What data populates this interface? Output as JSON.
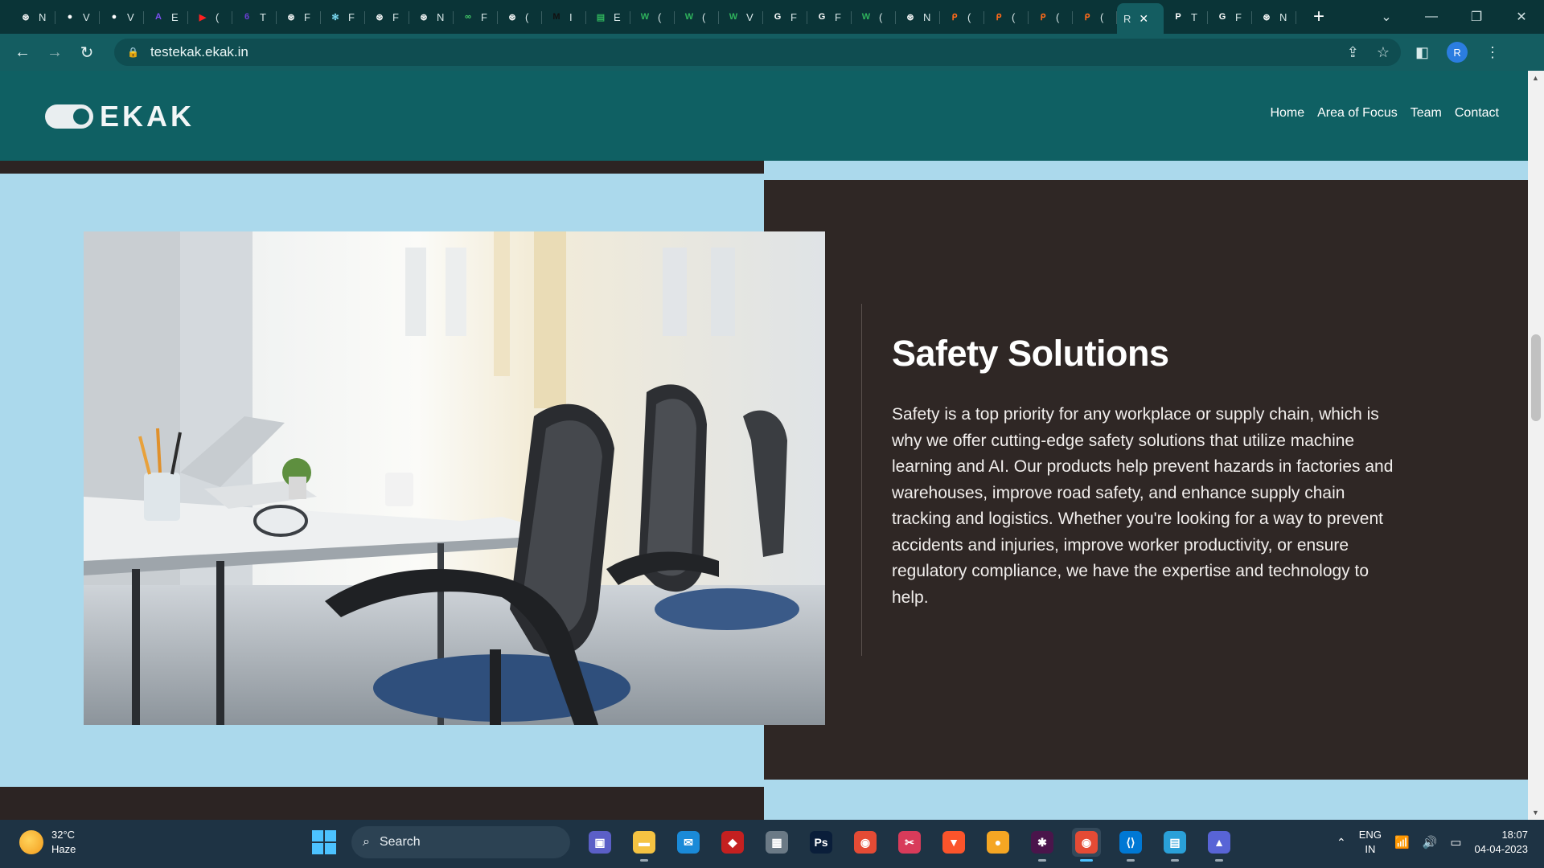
{
  "browser": {
    "tabs": [
      {
        "icon": "chatgpt-icon",
        "letter": "N",
        "color": "#ffffff",
        "glyph": "⊛"
      },
      {
        "icon": "github-icon",
        "letter": "V",
        "color": "#ffffff",
        "glyph": "●"
      },
      {
        "icon": "github-icon",
        "letter": "V",
        "color": "#ffffff",
        "glyph": "●"
      },
      {
        "icon": "app-a-icon",
        "letter": "E",
        "color": "#7b4ff0",
        "glyph": "A"
      },
      {
        "icon": "youtube-icon",
        "letter": "(",
        "color": "#ff2020",
        "glyph": "▶"
      },
      {
        "icon": "app-6-icon",
        "letter": "T",
        "color": "#6b3fd6",
        "glyph": "6"
      },
      {
        "icon": "openai-icon",
        "letter": "F",
        "color": "#ffffff",
        "glyph": "⊛"
      },
      {
        "icon": "react-icon",
        "letter": "F",
        "color": "#79d8f0",
        "glyph": "✻"
      },
      {
        "icon": "openai-icon",
        "letter": "F",
        "color": "#ffffff",
        "glyph": "⊛"
      },
      {
        "icon": "chatgpt-icon",
        "letter": "N",
        "color": "#ffffff",
        "glyph": "⊛"
      },
      {
        "icon": "infinity-icon",
        "letter": "F",
        "color": "#46d16b",
        "glyph": "∞"
      },
      {
        "icon": "openai-icon",
        "letter": "(",
        "color": "#ffffff",
        "glyph": "⊛"
      },
      {
        "icon": "medium-icon",
        "letter": "I",
        "color": "#111111",
        "glyph": "M"
      },
      {
        "icon": "sheets-icon",
        "letter": "E",
        "color": "#2fb35c",
        "glyph": "▤"
      },
      {
        "icon": "w-icon",
        "letter": "(",
        "color": "#2fb35c",
        "glyph": "W"
      },
      {
        "icon": "w-icon",
        "letter": "(",
        "color": "#2fb35c",
        "glyph": "W"
      },
      {
        "icon": "w-icon",
        "letter": "V",
        "color": "#2fb35c",
        "glyph": "W"
      },
      {
        "icon": "google-icon",
        "letter": "F",
        "color": "#ffffff",
        "glyph": "G"
      },
      {
        "icon": "google-icon",
        "letter": "F",
        "color": "#ffffff",
        "glyph": "G"
      },
      {
        "icon": "w-icon",
        "letter": "(",
        "color": "#2fb35c",
        "glyph": "W"
      },
      {
        "icon": "chatgpt-icon",
        "letter": "N",
        "color": "#ffffff",
        "glyph": "⊛"
      },
      {
        "icon": "p-orange-icon",
        "letter": "(",
        "color": "#ff6a1a",
        "glyph": "ᑭ"
      },
      {
        "icon": "p-orange-icon",
        "letter": "(",
        "color": "#ff6a1a",
        "glyph": "ᑭ"
      },
      {
        "icon": "p-orange-icon",
        "letter": "(",
        "color": "#ff6a1a",
        "glyph": "ᑭ"
      },
      {
        "icon": "p-orange-icon",
        "letter": "(",
        "color": "#ff6a1a",
        "glyph": "ᑭ"
      }
    ],
    "active_tab": {
      "letter": "R",
      "close": "✕"
    },
    "tabs_after": [
      {
        "icon": "p-black-icon",
        "letter": "T",
        "color": "#ffffff",
        "glyph": "P"
      },
      {
        "icon": "google-icon",
        "letter": "F",
        "color": "#ffffff",
        "glyph": "G"
      },
      {
        "icon": "chatgpt-icon",
        "letter": "N",
        "color": "#ffffff",
        "glyph": "⊛"
      }
    ],
    "new_tab": "+",
    "url": "testekak.ekak.in",
    "profile_initial": "R"
  },
  "site": {
    "logo_text": "EKAK",
    "nav": [
      "Home",
      "Area of Focus",
      "Team",
      "Contact"
    ],
    "feature_title": "Safety Solutions",
    "feature_body": "Safety is a top priority for any workplace or supply chain, which is why we offer cutting-edge safety solutions that utilize machine learning and AI. Our products help prevent hazards in factories and warehouses, improve road safety, and enhance supply chain tracking and logistics. Whether you're looking for a way to prevent accidents and injuries, improve worker productivity, or ensure regulatory compliance, we have the expertise and technology to help."
  },
  "taskbar": {
    "weather_temp": "32°C",
    "weather_desc": "Haze",
    "search_label": "Search",
    "apps": [
      {
        "name": "teams-icon",
        "glyph": "▣",
        "bg": "#5b5fc7",
        "running": false
      },
      {
        "name": "file-explorer-icon",
        "glyph": "▬",
        "bg": "#f5c342",
        "running": true
      },
      {
        "name": "mail-icon",
        "glyph": "✉",
        "bg": "#1a8ad8",
        "running": false
      },
      {
        "name": "app-red-icon",
        "glyph": "◆",
        "bg": "#c42020",
        "running": false
      },
      {
        "name": "calculator-icon",
        "glyph": "▦",
        "bg": "#6b7a86",
        "running": false
      },
      {
        "name": "photoshop-icon",
        "glyph": "Ps",
        "bg": "#0a1e3a",
        "running": false
      },
      {
        "name": "chrome-icon",
        "glyph": "◉",
        "bg": "#e44b35",
        "running": false
      },
      {
        "name": "snipping-tool-icon",
        "glyph": "✂",
        "bg": "#d83b5a",
        "running": false
      },
      {
        "name": "brave-icon",
        "glyph": "▼",
        "bg": "#fb542b",
        "running": false
      },
      {
        "name": "app-orange-icon",
        "glyph": "●",
        "bg": "#f5a623",
        "running": false
      },
      {
        "name": "slack-icon",
        "glyph": "✱",
        "bg": "#4a154b",
        "running": true
      },
      {
        "name": "chrome-profile-icon",
        "glyph": "◉",
        "bg": "#e44b35",
        "running": true,
        "focused": true
      },
      {
        "name": "vscode-icon",
        "glyph": "⟨⟩",
        "bg": "#0078d4",
        "running": true
      },
      {
        "name": "notepad-icon",
        "glyph": "▤",
        "bg": "#2aa0d8",
        "running": true
      },
      {
        "name": "app-triangle-icon",
        "glyph": "▲",
        "bg": "#5864d6",
        "running": true
      }
    ],
    "lang_line1": "ENG",
    "lang_line2": "IN",
    "time": "18:07",
    "date": "04-04-2023"
  }
}
